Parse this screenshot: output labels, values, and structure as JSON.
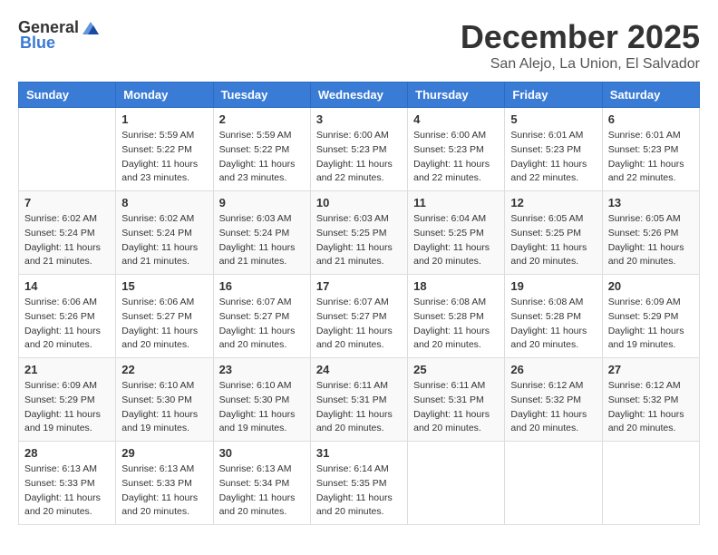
{
  "logo": {
    "text_general": "General",
    "text_blue": "Blue"
  },
  "title": {
    "month": "December 2025",
    "location": "San Alejo, La Union, El Salvador"
  },
  "days_of_week": [
    "Sunday",
    "Monday",
    "Tuesday",
    "Wednesday",
    "Thursday",
    "Friday",
    "Saturday"
  ],
  "weeks": [
    [
      {
        "day": "",
        "info": ""
      },
      {
        "day": "1",
        "info": "Sunrise: 5:59 AM\nSunset: 5:22 PM\nDaylight: 11 hours\nand 23 minutes."
      },
      {
        "day": "2",
        "info": "Sunrise: 5:59 AM\nSunset: 5:22 PM\nDaylight: 11 hours\nand 23 minutes."
      },
      {
        "day": "3",
        "info": "Sunrise: 6:00 AM\nSunset: 5:23 PM\nDaylight: 11 hours\nand 22 minutes."
      },
      {
        "day": "4",
        "info": "Sunrise: 6:00 AM\nSunset: 5:23 PM\nDaylight: 11 hours\nand 22 minutes."
      },
      {
        "day": "5",
        "info": "Sunrise: 6:01 AM\nSunset: 5:23 PM\nDaylight: 11 hours\nand 22 minutes."
      },
      {
        "day": "6",
        "info": "Sunrise: 6:01 AM\nSunset: 5:23 PM\nDaylight: 11 hours\nand 22 minutes."
      }
    ],
    [
      {
        "day": "7",
        "info": "Sunrise: 6:02 AM\nSunset: 5:24 PM\nDaylight: 11 hours\nand 21 minutes."
      },
      {
        "day": "8",
        "info": "Sunrise: 6:02 AM\nSunset: 5:24 PM\nDaylight: 11 hours\nand 21 minutes."
      },
      {
        "day": "9",
        "info": "Sunrise: 6:03 AM\nSunset: 5:24 PM\nDaylight: 11 hours\nand 21 minutes."
      },
      {
        "day": "10",
        "info": "Sunrise: 6:03 AM\nSunset: 5:25 PM\nDaylight: 11 hours\nand 21 minutes."
      },
      {
        "day": "11",
        "info": "Sunrise: 6:04 AM\nSunset: 5:25 PM\nDaylight: 11 hours\nand 20 minutes."
      },
      {
        "day": "12",
        "info": "Sunrise: 6:05 AM\nSunset: 5:25 PM\nDaylight: 11 hours\nand 20 minutes."
      },
      {
        "day": "13",
        "info": "Sunrise: 6:05 AM\nSunset: 5:26 PM\nDaylight: 11 hours\nand 20 minutes."
      }
    ],
    [
      {
        "day": "14",
        "info": "Sunrise: 6:06 AM\nSunset: 5:26 PM\nDaylight: 11 hours\nand 20 minutes."
      },
      {
        "day": "15",
        "info": "Sunrise: 6:06 AM\nSunset: 5:27 PM\nDaylight: 11 hours\nand 20 minutes."
      },
      {
        "day": "16",
        "info": "Sunrise: 6:07 AM\nSunset: 5:27 PM\nDaylight: 11 hours\nand 20 minutes."
      },
      {
        "day": "17",
        "info": "Sunrise: 6:07 AM\nSunset: 5:27 PM\nDaylight: 11 hours\nand 20 minutes."
      },
      {
        "day": "18",
        "info": "Sunrise: 6:08 AM\nSunset: 5:28 PM\nDaylight: 11 hours\nand 20 minutes."
      },
      {
        "day": "19",
        "info": "Sunrise: 6:08 AM\nSunset: 5:28 PM\nDaylight: 11 hours\nand 20 minutes."
      },
      {
        "day": "20",
        "info": "Sunrise: 6:09 AM\nSunset: 5:29 PM\nDaylight: 11 hours\nand 19 minutes."
      }
    ],
    [
      {
        "day": "21",
        "info": "Sunrise: 6:09 AM\nSunset: 5:29 PM\nDaylight: 11 hours\nand 19 minutes."
      },
      {
        "day": "22",
        "info": "Sunrise: 6:10 AM\nSunset: 5:30 PM\nDaylight: 11 hours\nand 19 minutes."
      },
      {
        "day": "23",
        "info": "Sunrise: 6:10 AM\nSunset: 5:30 PM\nDaylight: 11 hours\nand 19 minutes."
      },
      {
        "day": "24",
        "info": "Sunrise: 6:11 AM\nSunset: 5:31 PM\nDaylight: 11 hours\nand 20 minutes."
      },
      {
        "day": "25",
        "info": "Sunrise: 6:11 AM\nSunset: 5:31 PM\nDaylight: 11 hours\nand 20 minutes."
      },
      {
        "day": "26",
        "info": "Sunrise: 6:12 AM\nSunset: 5:32 PM\nDaylight: 11 hours\nand 20 minutes."
      },
      {
        "day": "27",
        "info": "Sunrise: 6:12 AM\nSunset: 5:32 PM\nDaylight: 11 hours\nand 20 minutes."
      }
    ],
    [
      {
        "day": "28",
        "info": "Sunrise: 6:13 AM\nSunset: 5:33 PM\nDaylight: 11 hours\nand 20 minutes."
      },
      {
        "day": "29",
        "info": "Sunrise: 6:13 AM\nSunset: 5:33 PM\nDaylight: 11 hours\nand 20 minutes."
      },
      {
        "day": "30",
        "info": "Sunrise: 6:13 AM\nSunset: 5:34 PM\nDaylight: 11 hours\nand 20 minutes."
      },
      {
        "day": "31",
        "info": "Sunrise: 6:14 AM\nSunset: 5:35 PM\nDaylight: 11 hours\nand 20 minutes."
      },
      {
        "day": "",
        "info": ""
      },
      {
        "day": "",
        "info": ""
      },
      {
        "day": "",
        "info": ""
      }
    ]
  ]
}
